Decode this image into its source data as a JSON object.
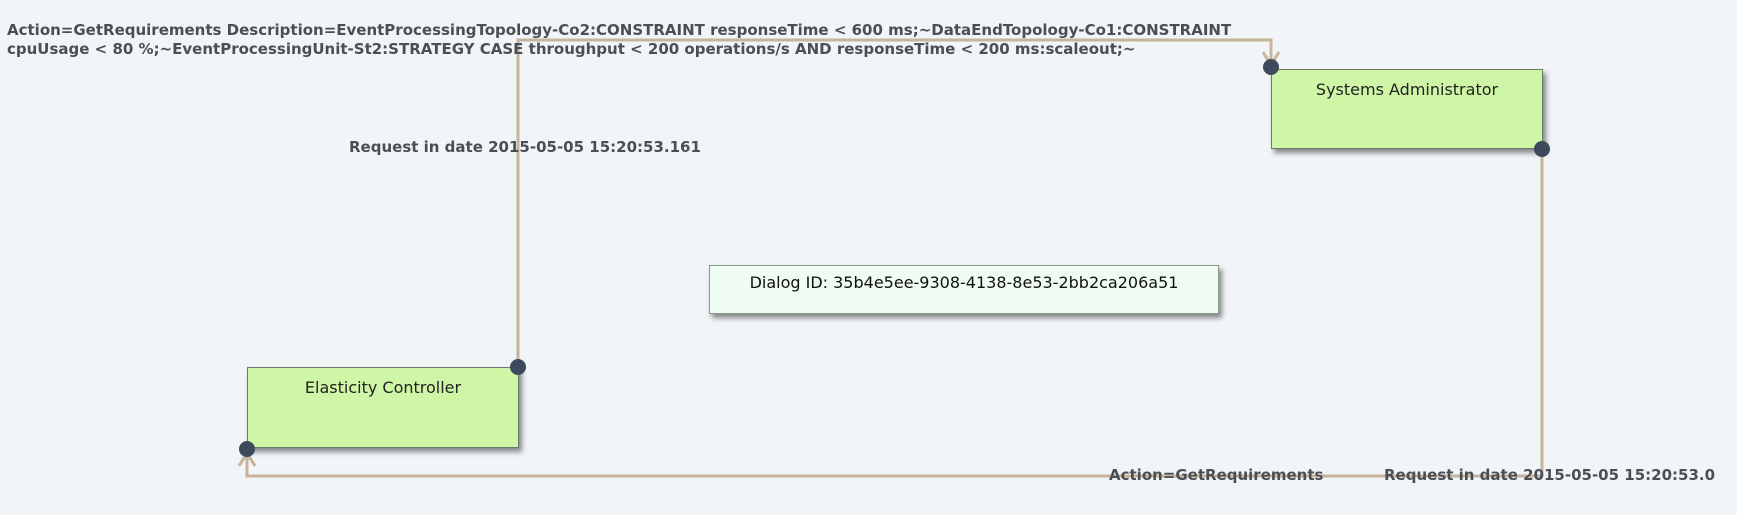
{
  "nodes": {
    "sysadmin": "Systems Administrator",
    "elastic": "Elasticity Controller"
  },
  "dialog": {
    "label": "Dialog ID: 35b4e5ee-9308-4138-8e53-2bb2ca206a51"
  },
  "messages": {
    "top_line1": "Action=GetRequirements Description=EventProcessingTopology-Co2:CONSTRAINT responseTime < 600 ms;~DataEndTopology-Co1:CONSTRAINT",
    "top_line2": "cpuUsage < 80 %;~EventProcessingUnit-St2:STRATEGY CASE throughput < 200 operations/s AND responseTime < 200 ms:scaleout;~",
    "top_date": "Request in date 2015-05-05 15:20:53.161",
    "bottom": "Action=GetRequirements",
    "bottom_date": "Request in date 2015-05-05 15:20:53.0"
  },
  "colors": {
    "connector": "#c8b49a",
    "endpoint": "#3c4a5c",
    "node_fill": "#cff5a6",
    "dialog_fill": "#effcf1",
    "background": "#f1f5f8"
  }
}
